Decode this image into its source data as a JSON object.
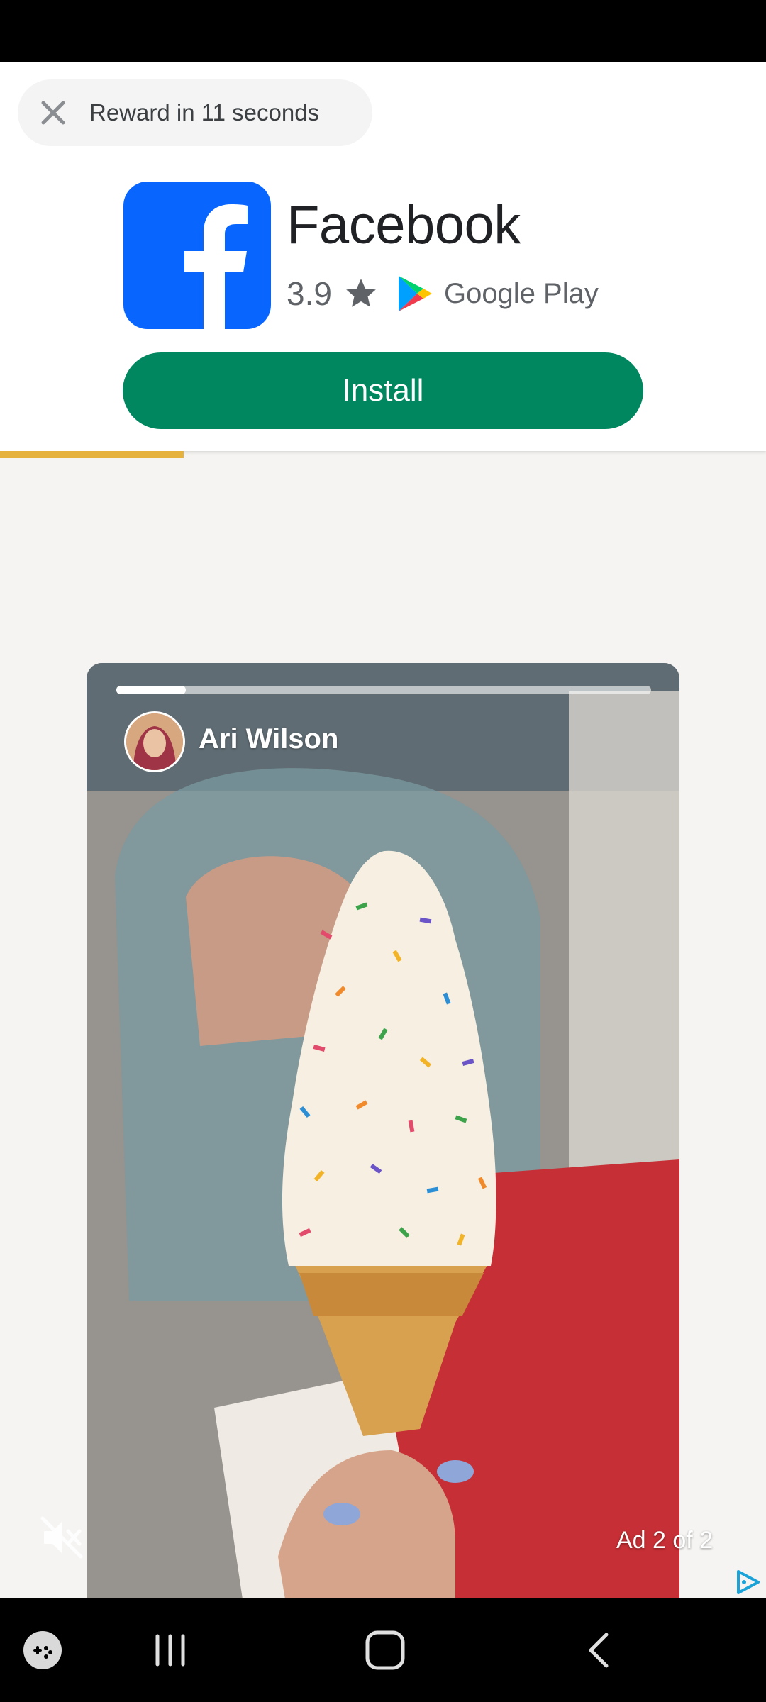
{
  "reward": {
    "text": "Reward in 11 seconds"
  },
  "app": {
    "name": "Facebook",
    "rating": "3.9",
    "store": "Google Play",
    "install_label": "Install",
    "brand_color": "#0866ff",
    "install_color": "#01875f"
  },
  "reward_progress": 0.24,
  "video": {
    "author": "Ari Wilson",
    "story_progress": 0.13,
    "ad_label": "Ad 2 of 2"
  },
  "colors": {
    "progress": "#e6b23d"
  },
  "nav": {
    "items": [
      "game-launcher-icon",
      "recent-apps-icon",
      "home-icon",
      "back-icon"
    ]
  }
}
